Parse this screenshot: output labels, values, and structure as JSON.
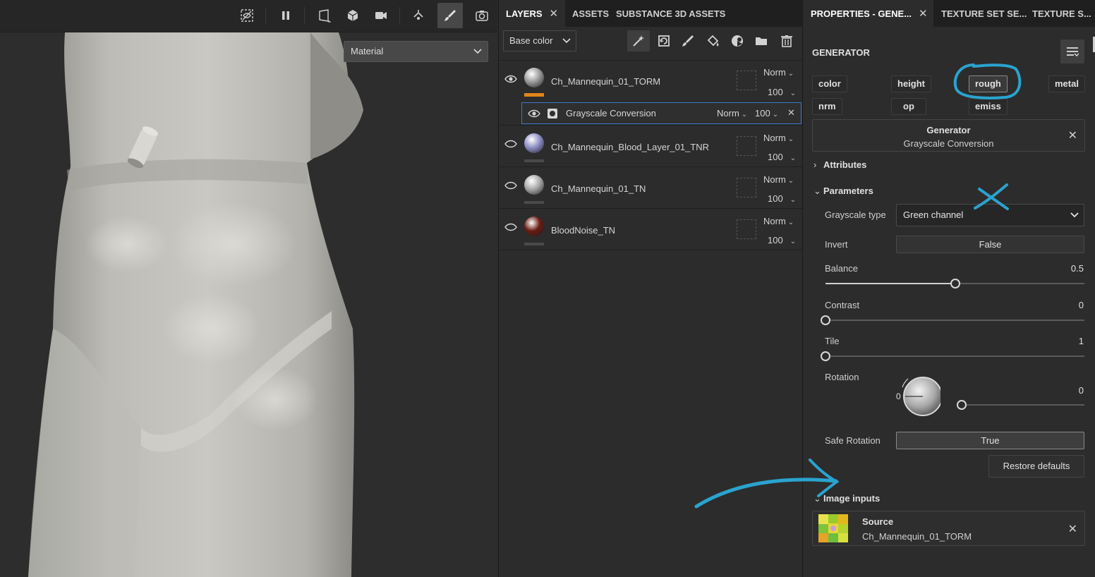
{
  "viewport": {
    "material_select": "Material",
    "toolbar_icons": [
      "hide-icon",
      "pause-icon",
      "perspective-icon",
      "cube-icon",
      "camera-icon",
      "symmetry-icon",
      "paintbrush-icon",
      "screenshot-icon"
    ]
  },
  "layers_panel": {
    "tabs": [
      {
        "label": "LAYERS",
        "active": true,
        "closable": true
      },
      {
        "label": "ASSETS",
        "active": false
      },
      {
        "label": "SUBSTANCE 3D ASSETS",
        "active": false
      }
    ],
    "channel": "Base color",
    "toolbar_icons": [
      "magic-wand-icon",
      "add-fill-icon",
      "paint-layer-icon",
      "fill-bucket-icon",
      "mask-icon",
      "folder-icon",
      "trash-icon"
    ],
    "layers": [
      {
        "name": "Ch_Mannequin_01_TORM",
        "blend": "Norm",
        "opacity": "100",
        "thumb_color": "#9a9a9a"
      },
      {
        "name": "Ch_Mannequin_Blood_Layer_01_TNR",
        "blend": "Norm",
        "opacity": "100",
        "thumb_color": "#8d8ec6"
      },
      {
        "name": "Ch_Mannequin_01_TN",
        "blend": "Norm",
        "opacity": "100",
        "thumb_color": "#a8a8a8"
      },
      {
        "name": "BloodNoise_TN",
        "blend": "Norm",
        "opacity": "100",
        "thumb_color": "#6a1b12"
      }
    ],
    "effect": {
      "name": "Grayscale Conversion",
      "blend": "Norm",
      "opacity": "100"
    }
  },
  "props_panel": {
    "tabs": [
      {
        "label": "PROPERTIES - GENE...",
        "active": true
      },
      {
        "label": "TEXTURE SET SE...",
        "active": false
      },
      {
        "label": "TEXTURE S...",
        "active": false
      }
    ],
    "heading": "GENERATOR",
    "channels": [
      "color",
      "height",
      "rough",
      "metal",
      "nrm",
      "op",
      "emiss"
    ],
    "active_channel": "rough",
    "generator": {
      "title": "Generator",
      "subtitle": "Grayscale Conversion"
    },
    "attributes_label": "Attributes",
    "parameters_label": "Parameters",
    "grayscale_type": {
      "label": "Grayscale type",
      "value": "Green channel"
    },
    "invert": {
      "label": "Invert",
      "value": "False"
    },
    "balance": {
      "label": "Balance",
      "value": "0.5",
      "fraction": 0.5
    },
    "contrast": {
      "label": "Contrast",
      "value": "0",
      "fraction": 0
    },
    "tile": {
      "label": "Tile",
      "value": "1",
      "fraction": 0
    },
    "rotation": {
      "label": "Rotation",
      "value": "0",
      "dial_value": "0"
    },
    "safe_rotation": {
      "label": "Safe Rotation",
      "value": "True"
    },
    "restore_label": "Restore defaults",
    "image_inputs_label": "Image inputs",
    "source": {
      "title": "Source",
      "value": "Ch_Mannequin_01_TORM"
    }
  },
  "annotation_color": "#2aa3cf"
}
